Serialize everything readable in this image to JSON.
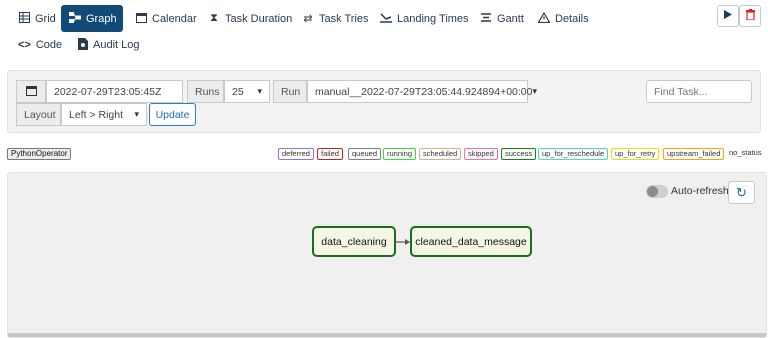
{
  "tabs": [
    {
      "label": "Grid",
      "icon": "grid-icon"
    },
    {
      "label": "Graph",
      "icon": "graph-icon",
      "active": true
    },
    {
      "label": "Calendar",
      "icon": "calendar-icon"
    },
    {
      "label": "Task Duration",
      "icon": "hourglass-icon"
    },
    {
      "label": "Task Tries",
      "icon": "retry-icon"
    },
    {
      "label": "Landing Times",
      "icon": "landing-icon"
    },
    {
      "label": "Gantt",
      "icon": "gantt-icon"
    },
    {
      "label": "Details",
      "icon": "warning-triangle-icon"
    }
  ],
  "tabs2": [
    {
      "label": "Code",
      "icon": "code-icon"
    },
    {
      "label": "Audit Log",
      "icon": "audit-log-icon"
    }
  ],
  "actions": {
    "trigger_icon": "play-icon",
    "delete_icon": "trash-icon"
  },
  "controls": {
    "base_date": "2022-07-29T23:05:45Z",
    "runs_label": "Runs",
    "runs_value": "25",
    "run_label": "Run",
    "run_value": "manual__2022-07-29T23:05:44.924894+00:00",
    "find_placeholder": "Find Task...",
    "layout_label": "Layout",
    "layout_value": "Left > Right",
    "update_label": "Update"
  },
  "operator_badge": "PythonOperator",
  "states": [
    {
      "label": "deferred",
      "color": "#9370db"
    },
    {
      "label": "failed",
      "color": "#d21e1e"
    },
    {
      "label": "queued",
      "color": "#808080"
    },
    {
      "label": "running",
      "color": "#33dd33"
    },
    {
      "label": "scheduled",
      "color": "#d2b48c"
    },
    {
      "label": "skipped",
      "color": "#ff69b4"
    },
    {
      "label": "success",
      "color": "#118811"
    },
    {
      "label": "up_for_reschedule",
      "color": "#40e0d0"
    },
    {
      "label": "up_for_retry",
      "color": "#ffd700"
    },
    {
      "label": "upstream_failed",
      "color": "#ffa500"
    },
    {
      "label": "no_status",
      "color": "#ffffff"
    }
  ],
  "graph": {
    "auto_refresh_label": "Auto-refresh",
    "auto_refresh_on": false,
    "nodes": [
      "data_cleaning",
      "cleaned_data_message"
    ],
    "node_border_color": "#1a6d1a"
  }
}
